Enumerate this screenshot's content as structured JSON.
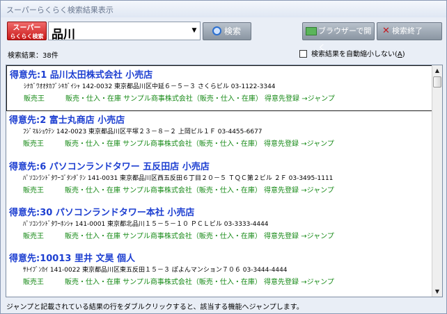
{
  "window": {
    "title": "スーパーらくらく検索結果表示"
  },
  "toolbar": {
    "logo_line1": "スーパー",
    "logo_line2": "らくらく検索",
    "query": "品川",
    "search_label": "検索",
    "open_browser_label": "ブラウザーで開く",
    "close_label": "検索終了"
  },
  "summary": {
    "count": "検索結果：38件",
    "autoshrink_label": "検索結果を自動縮小しない(",
    "autoshrink_accel": "A",
    "autoshrink_suffix": ")"
  },
  "results": [
    {
      "header": "得意先:1 品川太田株式会社 小売店",
      "address": "ｼﾅｶﾞﾜｵｵﾀｶﾌﾞｼｷｶﾞｲｼｬ 142-0032 東京都品川区中延６－５－３ さくらビル 03-1122-3344",
      "app": "販売王",
      "link": "販売・仕入・在庫 サンプル商事株式会社（販売・仕入・在庫） 得意先登録 →ジャンプ"
    },
    {
      "header": "得意先:2 富士丸商店 小売店",
      "address": "ﾌｼﾞﾏﾙｼｮｳﾃﾝ 142-0023 東京都品川区平塚２３－８－２ 上岡ビル１Ｆ 03-4455-6677",
      "app": "販売王",
      "link": "販売・仕入・在庫 サンプル商事株式会社（販売・仕入・在庫） 得意先登録 →ジャンプ"
    },
    {
      "header": "得意先:6 パソコンランドタワー 五反田店 小売店",
      "address": "ﾊﾟｿｺﾝﾗﾝﾄﾞﾀﾜｰｺﾞﾀﾝﾀﾞﾃﾝ 141-0031 東京都品川区西五反田６丁目２０－５ ＴＱＣ第２ビル ２Ｆ 03-3495-1111",
      "app": "販売王",
      "link": "販売・仕入・在庫 サンプル商事株式会社（販売・仕入・在庫） 得意先登録 →ジャンプ"
    },
    {
      "header": "得意先:30 パソコンランドタワー本社 小売店",
      "address": "ﾊﾟｿｺﾝﾗﾝﾄﾞﾀﾜｰﾎﾝｼｬ 141-0001 東京都北品川１５－５－１０ ＰＣＬビル 03-3333-4444",
      "app": "販売王",
      "link": "販売・仕入・在庫 サンプル商事株式会社（販売・仕入・在庫） 得意先登録 →ジャンプ"
    },
    {
      "header": "得意先:10013 里井 文昊 個人",
      "address": "ｻﾄｲﾌﾞﾝｶｲ 141-0022 東京都品川区東五反田１５－３ ぽよんマンション７０６ 03-3444-4444",
      "app": "販売王",
      "link": "販売・仕入・在庫 サンプル商事株式会社（販売・仕入・在庫） 得意先登録 →ジャンプ"
    }
  ],
  "status": {
    "message": "ジャンプと記載されている結果の行をダブルクリックすると、該当する機能へジャンプします。"
  }
}
